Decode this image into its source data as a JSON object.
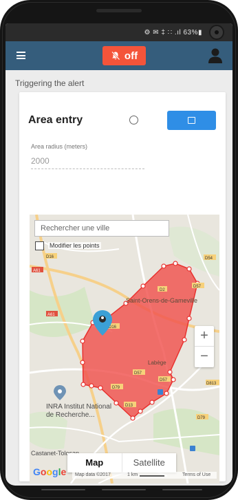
{
  "status_bar": {
    "text": "⚙ ✉ ‡ ∷ .ıl 63%▮"
  },
  "app_bar": {
    "off_label": "off"
  },
  "alert": {
    "subtitle": "Triggering the alert",
    "area_entry_label": "Area entry",
    "radius_label": "Area radius (meters)",
    "radius_value": "2000"
  },
  "map": {
    "search_placeholder": "Rechercher une ville",
    "polygon_checkbox_label": "Modifier les points",
    "zoom_in": "+",
    "zoom_out": "−",
    "map_tab": "Map",
    "satellite_tab": "Satellite",
    "google_logo": "Google",
    "footer_data": "Map data ©2017",
    "footer_scale": "1 km",
    "footer_terms": "Terms of Use",
    "place_labels": [
      "Saint-Orens-de-Gameville",
      "Labège",
      "INRA Institut National",
      "de Recherche...",
      "Castanet-Tolosan"
    ],
    "road_labels": [
      "D16",
      "D54",
      "A61",
      "A61",
      "D57",
      "D2",
      "D16",
      "D57",
      "D79",
      "D13",
      "D57",
      "D79",
      "D813"
    ]
  },
  "colors": {
    "app_bar": "#355d7c",
    "off_button": "#f4543a",
    "blue_button": "#2f8ee6",
    "polygon_fill": "#f0524e",
    "marker": "#3ba0d6"
  }
}
